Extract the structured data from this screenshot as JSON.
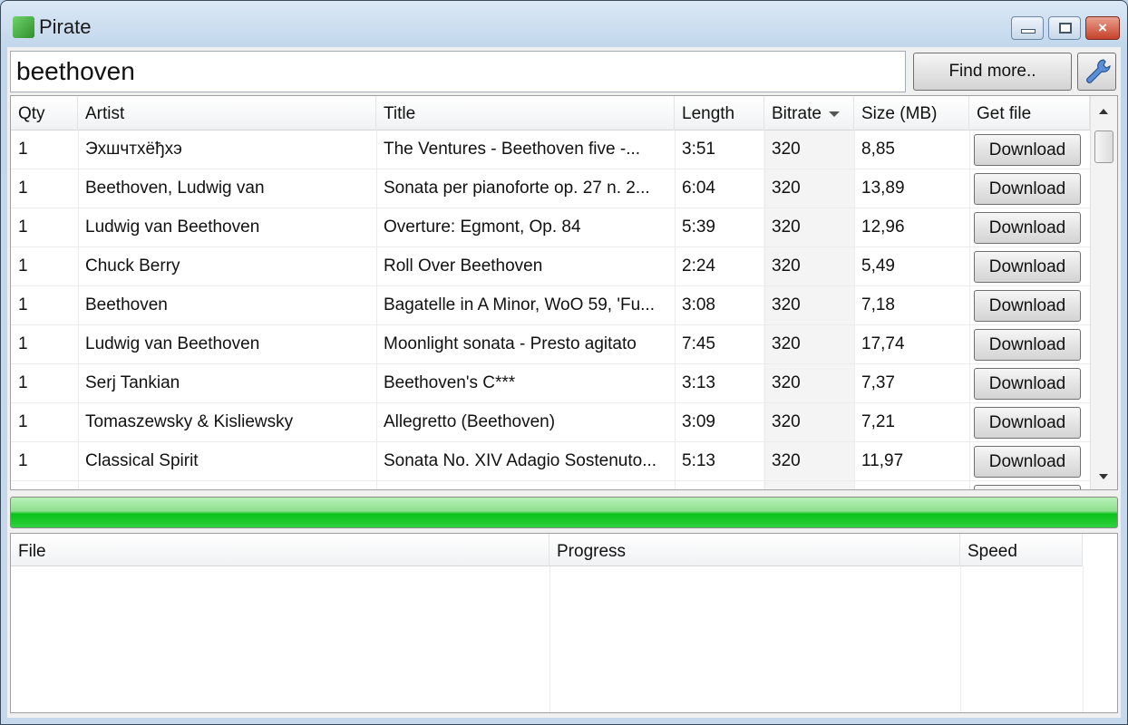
{
  "window": {
    "title": "Pirate",
    "minimize": "minimize",
    "maximize": "maximize",
    "close": "×"
  },
  "search": {
    "value": "beethoven"
  },
  "toolbar": {
    "find_more": "Find more..",
    "settings_icon": "wrench-icon"
  },
  "results": {
    "columns": [
      "Qty",
      "Artist",
      "Title",
      "Length",
      "Bitrate",
      "Size (MB)",
      "Get file"
    ],
    "sorted_column": "Bitrate",
    "sort_direction": "descending",
    "rows": [
      {
        "qty": "1",
        "artist": "Эхшчтхёђхэ",
        "title": "The Ventures - Beethoven five -...",
        "length": "3:51",
        "bitrate": "320",
        "size": "8,85",
        "action": "Download"
      },
      {
        "qty": "1",
        "artist": "Beethoven, Ludwig van",
        "title": "Sonata per pianoforte op. 27 n. 2...",
        "length": "6:04",
        "bitrate": "320",
        "size": "13,89",
        "action": "Download"
      },
      {
        "qty": "1",
        "artist": "Ludwig van Beethoven",
        "title": "Overture: Egmont, Op. 84",
        "length": "5:39",
        "bitrate": "320",
        "size": "12,96",
        "action": "Download"
      },
      {
        "qty": "1",
        "artist": "Chuck Berry",
        "title": "Roll Over Beethoven",
        "length": "2:24",
        "bitrate": "320",
        "size": "5,49",
        "action": "Download"
      },
      {
        "qty": "1",
        "artist": "Beethoven",
        "title": "Bagatelle in A Minor, WoO 59, 'Fu...",
        "length": "3:08",
        "bitrate": "320",
        "size": "7,18",
        "action": "Download"
      },
      {
        "qty": "1",
        "artist": "Ludwig van Beethoven",
        "title": "Moonlight sonata - Presto agitato",
        "length": "7:45",
        "bitrate": "320",
        "size": "17,74",
        "action": "Download"
      },
      {
        "qty": "1",
        "artist": "Serj Tankian",
        "title": "Beethoven's C***",
        "length": "3:13",
        "bitrate": "320",
        "size": "7,37",
        "action": "Download"
      },
      {
        "qty": "1",
        "artist": "Tomaszewsky & Kisliewsky",
        "title": "Allegretto (Beethoven)",
        "length": "3:09",
        "bitrate": "320",
        "size": "7,21",
        "action": "Download"
      },
      {
        "qty": "1",
        "artist": "Classical Spirit",
        "title": "Sonata No. XIV Adagio Sostenuto...",
        "length": "5:13",
        "bitrate": "320",
        "size": "11,97",
        "action": "Download"
      }
    ]
  },
  "overall_progress": {
    "percent": 100,
    "color": "#0ac21a"
  },
  "downloads": {
    "columns": [
      "File",
      "Progress",
      "Speed"
    ]
  }
}
